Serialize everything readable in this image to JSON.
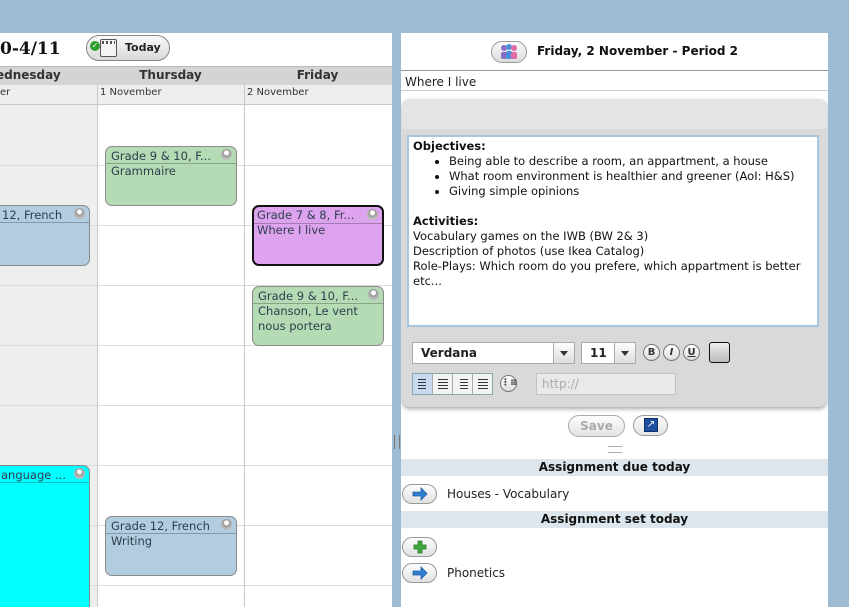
{
  "calendar": {
    "title": "0-4/11",
    "today_label": "Today",
    "days": [
      "ednesday",
      "Thursday",
      "Friday"
    ],
    "dates": [
      "er",
      "1 November",
      "2 November"
    ],
    "events": [
      {
        "title": "Grade 9 & 10, F...",
        "sub": "Grammaire"
      },
      {
        "title": "12, French",
        "sub": ""
      },
      {
        "title": "Grade 7 & 8, Fr...",
        "sub": "Where I live"
      },
      {
        "title": "Grade 9 & 10, F...",
        "sub": "Chanson, Le vent nous portera"
      },
      {
        "title": "anguage ...",
        "sub": ""
      },
      {
        "title": "Grade 12, French",
        "sub": "Writing"
      }
    ]
  },
  "lesson": {
    "header_title": "Friday, 2 November - Period 2",
    "title_value": "Where I live",
    "editor": {
      "objectives_heading": "Objectives:",
      "objectives": [
        "Being able to describe a room, an appartment, a house",
        "What room environment is healthier and greener (AoI: H&S)",
        "Giving simple opinions"
      ],
      "activities_heading": "Activities:",
      "activities": [
        "Vocabulary games on the IWB (BW 2& 3)",
        "Description of photos (use Ikea Catalog)",
        "Role-Plays: Which room do you prefere, which appartment is better etc..."
      ]
    },
    "toolbar": {
      "font": "Verdana",
      "size": "11",
      "bold": "B",
      "italic": "I",
      "underline": "U",
      "link_placeholder": "http://"
    },
    "save_label": "Save",
    "due_heading": "Assignment due today",
    "due_items": [
      "Houses - Vocabulary"
    ],
    "set_heading": "Assignment set today",
    "set_items": [
      "Phonetics"
    ]
  }
}
